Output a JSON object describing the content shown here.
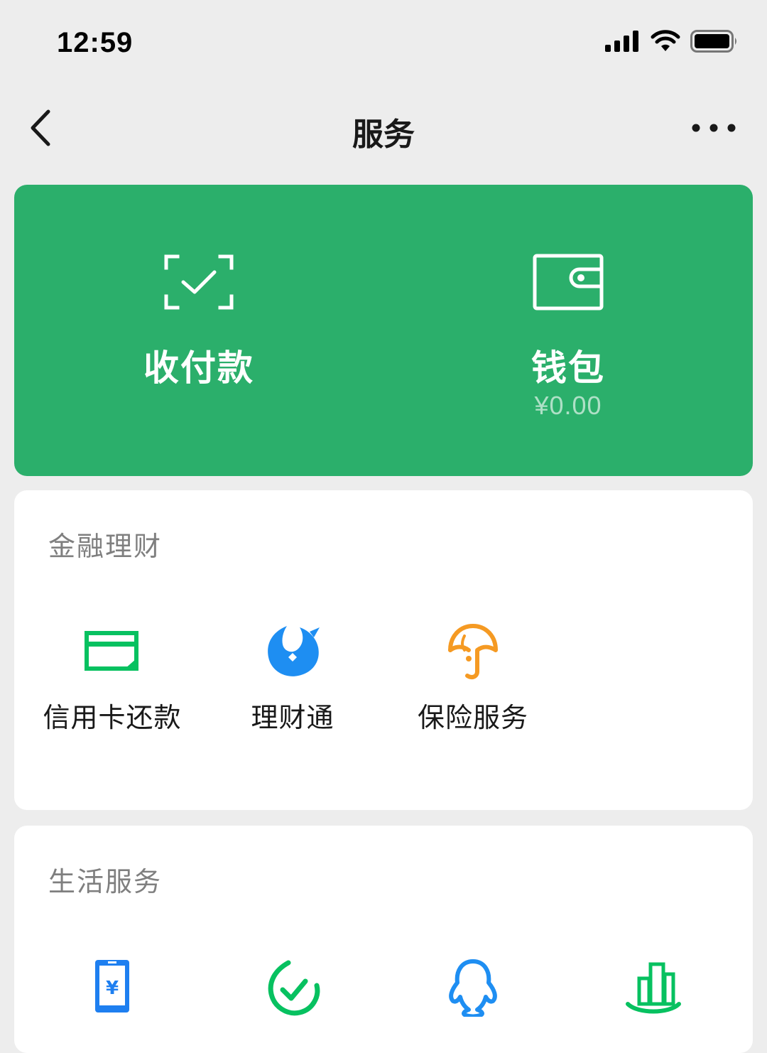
{
  "status_bar": {
    "time": "12:59"
  },
  "nav": {
    "title": "服务"
  },
  "hero": {
    "pay": {
      "label": "收付款"
    },
    "wallet": {
      "label": "钱包",
      "balance": "¥0.00"
    }
  },
  "finance": {
    "title": "金融理财",
    "items": [
      {
        "label": "信用卡还款",
        "icon": "credit-card-icon",
        "color": "#07c160"
      },
      {
        "label": "理财通",
        "icon": "wealth-drop-icon",
        "color": "#1e8ef2"
      },
      {
        "label": "保险服务",
        "icon": "insurance-umbrella-icon",
        "color": "#f59a23"
      }
    ]
  },
  "life": {
    "title": "生活服务",
    "items": [
      {
        "icon": "mobile-topup-icon",
        "color": "#1e7ff0"
      },
      {
        "icon": "check-drop-icon",
        "color": "#07c160"
      },
      {
        "icon": "qq-penguin-icon",
        "color": "#1e8ef2"
      },
      {
        "icon": "city-services-icon",
        "color": "#07c160"
      }
    ]
  },
  "colors": {
    "hero_green": "#2baf6b",
    "page_bg": "#ededed"
  }
}
